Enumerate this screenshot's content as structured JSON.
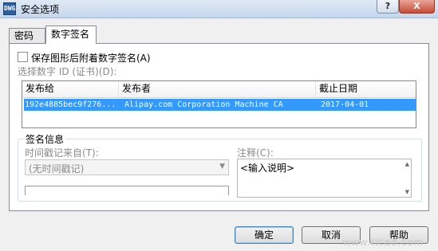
{
  "window": {
    "title": "安全选项",
    "icon": "app-icon",
    "help_btn": "?",
    "close_btn": "X"
  },
  "tabs": [
    {
      "label": "密码",
      "active": false
    },
    {
      "label": "数字签名",
      "active": true
    }
  ],
  "options": {
    "save_with_signature": {
      "label": "保存图形后附着数字签名(A)",
      "checked": false
    }
  },
  "select_id_label": "选择数字 ID (证书)(D):",
  "certificates": {
    "columns": [
      "发布给",
      "发布者",
      "截止日期"
    ],
    "rows": [
      {
        "issued_to": "192e4885bec9f276...",
        "issuer": "Alipay.com Corporation Machine CA",
        "expires": "2017-04-01",
        "selected": true
      }
    ],
    "selected_color": "#3399ff"
  },
  "signature_info": {
    "group_title": "签名信息",
    "timestamp_label": "时间戳记来自(T):",
    "timestamp_value": "(无时间戳记)",
    "comment_label": "注释(C):",
    "comment_placeholder": "<输入说明>"
  },
  "buttons": {
    "ok": "确定",
    "cancel": "取消",
    "help": "帮助"
  },
  "watermark": "www.ttcad.com"
}
